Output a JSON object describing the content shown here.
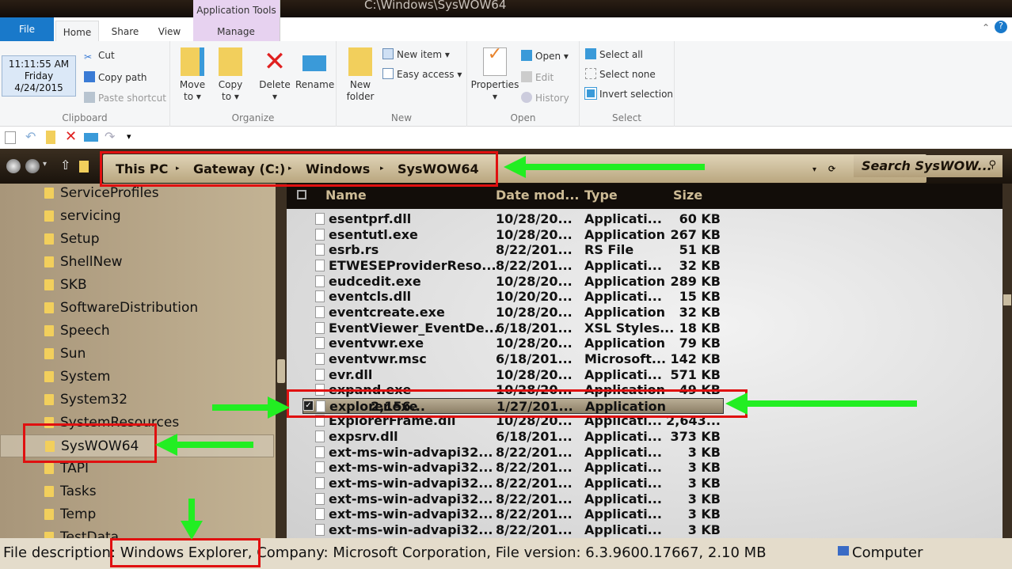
{
  "window": {
    "title": "C:\\Windows\\SysWOW64",
    "context_tab": "Application Tools"
  },
  "tabs": [
    "File",
    "Home",
    "Share",
    "View",
    "Manage"
  ],
  "clock": {
    "time": "11:11:55 AM",
    "day": "Friday",
    "date": "4/24/2015"
  },
  "ribbon": {
    "clipboard": {
      "label": "Clipboard",
      "cut": "Cut",
      "copy_path": "Copy path",
      "paste_shortcut": "Paste shortcut"
    },
    "organize": {
      "label": "Organize",
      "move_to": "Move to",
      "copy_to": "Copy to",
      "delete": "Delete",
      "rename": "Rename"
    },
    "new": {
      "label": "New",
      "new_folder": "New folder",
      "new_item": "New item",
      "easy_access": "Easy access"
    },
    "open": {
      "label": "Open",
      "properties": "Properties",
      "open": "Open",
      "edit": "Edit",
      "history": "History"
    },
    "select": {
      "label": "Select",
      "select_all": "Select all",
      "select_none": "Select none",
      "invert": "Invert selection"
    }
  },
  "breadcrumb": [
    "This PC",
    "Gateway (C:)",
    "Windows",
    "SysWOW64"
  ],
  "search": {
    "placeholder": "Search SysWOW..."
  },
  "nav": [
    "ServiceProfiles",
    "servicing",
    "Setup",
    "ShellNew",
    "SKB",
    "SoftwareDistribution",
    "Speech",
    "Sun",
    "System",
    "System32",
    "SystemResources",
    "SysWOW64",
    "TAPI",
    "Tasks",
    "Temp",
    "TestData"
  ],
  "nav_selected": "SysWOW64",
  "columns": [
    "Name",
    "Date mod...",
    "Type",
    "Size"
  ],
  "files": [
    [
      "esentprf.dll",
      "10/28/20...",
      "Applicati...",
      "60 KB"
    ],
    [
      "esentutl.exe",
      "10/28/20...",
      "Application",
      "267 KB"
    ],
    [
      "esrb.rs",
      "8/22/201...",
      "RS File",
      "51 KB"
    ],
    [
      "ETWESEProviderReso...",
      "8/22/201...",
      "Applicati...",
      "32 KB"
    ],
    [
      "eudcedit.exe",
      "10/28/20...",
      "Application",
      "289 KB"
    ],
    [
      "eventcls.dll",
      "10/20/20...",
      "Applicati...",
      "15 KB"
    ],
    [
      "eventcreate.exe",
      "10/28/20...",
      "Application",
      "32 KB"
    ],
    [
      "EventViewer_EventDe...",
      "6/18/201...",
      "XSL Styles...",
      "18 KB"
    ],
    [
      "eventvwr.exe",
      "10/28/20...",
      "Application",
      "79 KB"
    ],
    [
      "eventvwr.msc",
      "6/18/201...",
      "Microsoft...",
      "142 KB"
    ],
    [
      "evr.dll",
      "10/28/20...",
      "Applicati...",
      "571 KB"
    ],
    [
      "expand.exe",
      "10/28/20...",
      "Application",
      "49 KB"
    ],
    [
      "explorer.exe",
      "1/27/201...",
      "Application",
      "2,156..."
    ],
    [
      "ExplorerFrame.dll",
      "10/28/20...",
      "Applicati...",
      "2,643..."
    ],
    [
      "expsrv.dll",
      "6/18/201...",
      "Applicati...",
      "373 KB"
    ],
    [
      "ext-ms-win-advapi32...",
      "8/22/201...",
      "Applicati...",
      "3 KB"
    ],
    [
      "ext-ms-win-advapi32...",
      "8/22/201...",
      "Applicati...",
      "3 KB"
    ],
    [
      "ext-ms-win-advapi32...",
      "8/22/201...",
      "Applicati...",
      "3 KB"
    ],
    [
      "ext-ms-win-advapi32...",
      "8/22/201...",
      "Applicati...",
      "3 KB"
    ],
    [
      "ext-ms-win-advapi32...",
      "8/22/201...",
      "Applicati...",
      "3 KB"
    ],
    [
      "ext-ms-win-advapi32...",
      "8/22/201...",
      "Applicati...",
      "3 KB"
    ]
  ],
  "selected_file": "explorer.exe",
  "status": {
    "desc_label": "File description:",
    "desc_value": "Windows Explorer,",
    "rest": "Company: Microsoft Corporation, File version: 6.3.9600.17667,  2.10 MB",
    "computer": "Computer"
  },
  "colors": {
    "annotation_box": "#e01010",
    "annotation_arrow": "#22ee22",
    "file_tab": "#1979ca"
  }
}
